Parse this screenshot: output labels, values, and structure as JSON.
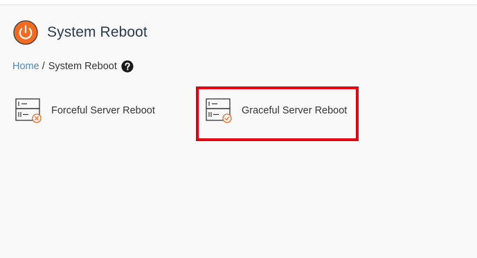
{
  "header": {
    "title": "System Reboot",
    "icon": "power-icon",
    "icon_color": "#f26b21"
  },
  "breadcrumb": {
    "home_label": "Home",
    "separator": "/",
    "current_label": "System Reboot",
    "help_icon": "question-circle-icon"
  },
  "tools": [
    {
      "label": "Forceful Server Reboot",
      "icon": "server-x-icon"
    },
    {
      "label": "Graceful Server Reboot",
      "icon": "server-check-icon"
    }
  ],
  "colors": {
    "accent": "#f26b21",
    "link": "#4b87c2",
    "highlight": "#e8000e",
    "background": "#f9f9f9"
  }
}
